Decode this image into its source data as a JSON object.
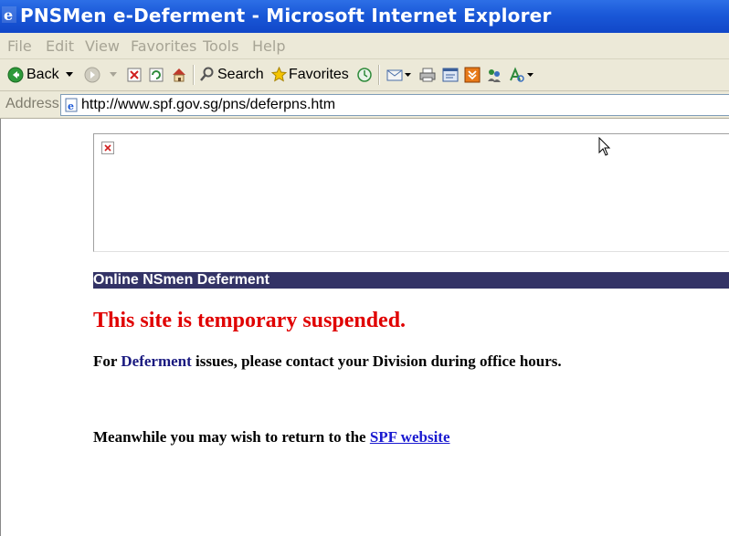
{
  "window": {
    "title": "PNSMen e-Deferment - Microsoft Internet Explorer"
  },
  "menu": [
    "File",
    "Edit",
    "View",
    "Favorites",
    "Tools",
    "Help"
  ],
  "toolbar": {
    "back_label": "Back",
    "search_label": "Search",
    "favorites_label": "Favorites"
  },
  "address": {
    "label": "Address",
    "url": "http://www.spf.gov.sg/pns/deferpns.htm"
  },
  "page": {
    "section_header": "Online NSmen Deferment",
    "suspended_message": "This site is temporary suspended.",
    "contact_prefix": "For ",
    "contact_highlight": "Deferment",
    "contact_suffix": " issues, please contact your Division during office hours.",
    "meanwhile_text": "Meanwhile you may wish to return to the ",
    "spf_link": "SPF website"
  },
  "colors": {
    "title_bar": "#1a58d8",
    "section_header_bg": "#333366",
    "suspended_text": "#e00000",
    "link": "#1a1ad0"
  }
}
